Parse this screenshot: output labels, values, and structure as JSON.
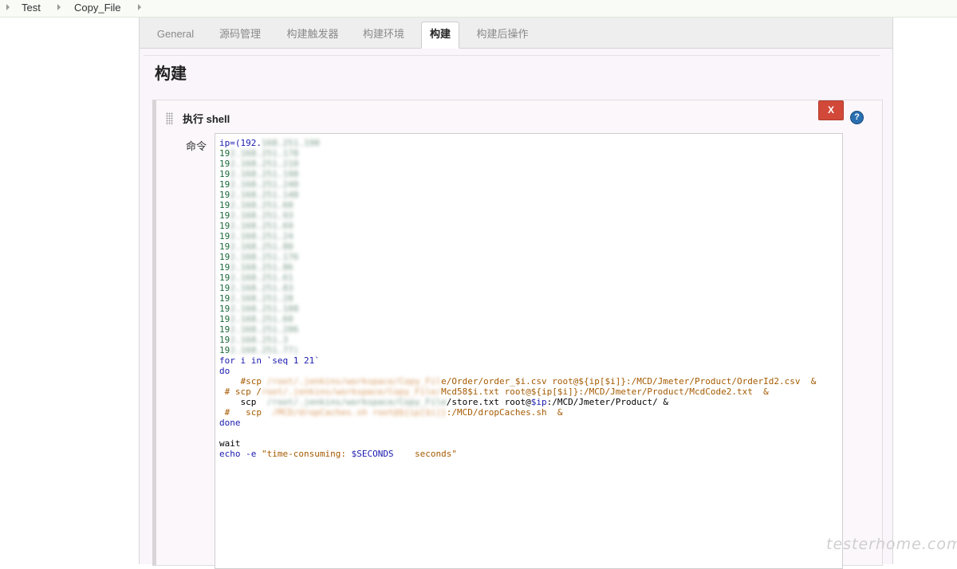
{
  "breadcrumb": {
    "items": [
      "Test",
      "Copy_File"
    ]
  },
  "tabs": [
    {
      "label": "General",
      "active": false
    },
    {
      "label": "源码管理",
      "active": false
    },
    {
      "label": "构建触发器",
      "active": false
    },
    {
      "label": "构建环境",
      "active": false
    },
    {
      "label": "构建",
      "active": true
    },
    {
      "label": "构建后操作",
      "active": false
    }
  ],
  "page_title": "构建",
  "build_step": {
    "title": "执行 shell",
    "close_label": "X",
    "help_label": "?",
    "field_label": "命令",
    "code": {
      "ip_open": "ip=(192.",
      "ip_lines": [
        "192.168.251.178",
        "192.168.251.210",
        "192.168.251.198",
        "192.168.251.240",
        "192.168.251.148",
        "192.168.251.60",
        "192.168.251.93",
        "192.168.251.69",
        "192.168.251.24",
        "192.168.251.80",
        "192.168.251.176",
        "192.168.251.86",
        "192.168.251.61",
        "192.168.251.83",
        "192.168.251.28",
        "192.168.251.108",
        "192.168.251.60",
        "192.168.251.206",
        "192.168.251.3",
        "192.168.251.77)"
      ],
      "for_line": "for i in `seq 1 21`",
      "do": "do",
      "scp1_pre": "    #scp ",
      "scp1_tail": "e/Order/order_$i.csv root@${ip[$i]}:/MCD/Jmeter/Product/OrderId2.csv  &",
      "scp2_pre": " # scp /",
      "scp2_tail": "Mcd58$i.txt root@${ip[$i]}:/MCD/Jmeter/Product/McdCode2.txt  &",
      "scp3_pre": "    scp  ",
      "scp3_tail": "/store.txt root@",
      "scp3_var": "$ip",
      "scp3_end": ":/MCD/Jmeter/Product/ &",
      "scp4_pre": " #   scp  ",
      "scp4_tail": ":/MCD/dropCaches.sh  &",
      "done": "done",
      "wait": "wait",
      "echo_cmd": "echo -e ",
      "echo_str1": "\"time-consuming: ",
      "echo_var": "$SECONDS",
      "echo_str2": "    seconds\""
    }
  },
  "watermark": "testerhome.com"
}
